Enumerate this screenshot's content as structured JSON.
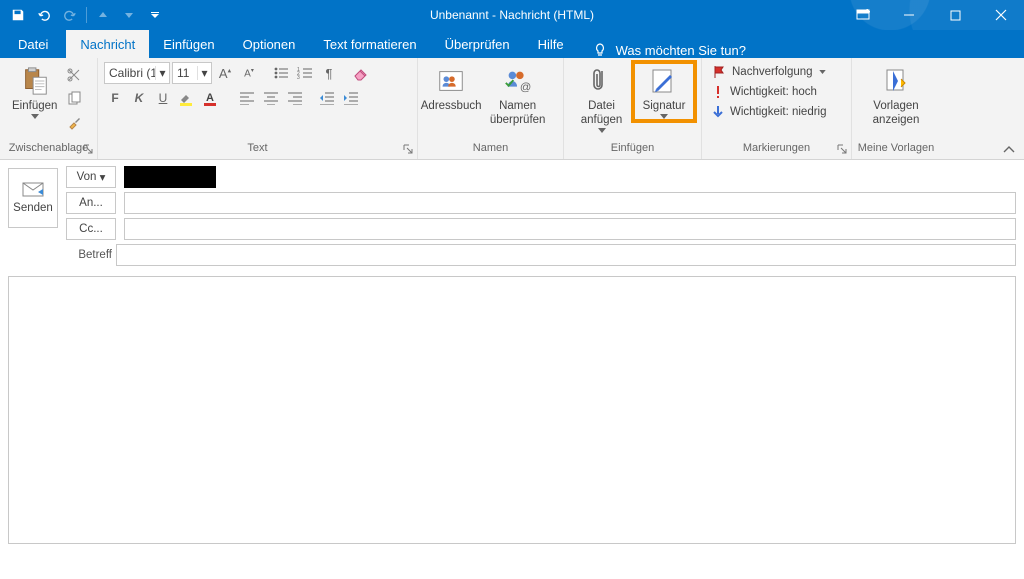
{
  "window": {
    "title": "Unbenannt  -  Nachricht (HTML)"
  },
  "tabs": {
    "file": "Datei",
    "message": "Nachricht",
    "insert": "Einfügen",
    "options": "Optionen",
    "format": "Text formatieren",
    "review": "Überprüfen",
    "help": "Hilfe",
    "tellme": "Was möchten Sie tun?"
  },
  "ribbon": {
    "clipboard": {
      "paste": "Einfügen",
      "group": "Zwischenablage"
    },
    "font": {
      "name": "Calibri (1",
      "size": "11",
      "group": "Text"
    },
    "names": {
      "addressbook": "Adressbuch",
      "checknames": "Namen überprüfen",
      "group": "Namen"
    },
    "include": {
      "attachfile": "Datei anfügen",
      "signature": "Signatur",
      "group": "Einfügen"
    },
    "tags": {
      "followup": "Nachverfolgung",
      "high": "Wichtigkeit: hoch",
      "low": "Wichtigkeit: niedrig",
      "group": "Markierungen"
    },
    "templates": {
      "show": "Vorlagen anzeigen",
      "group": "Meine Vorlagen"
    }
  },
  "compose": {
    "send": "Senden",
    "from": "Von",
    "to": "An...",
    "cc": "Cc...",
    "subject": "Betreff"
  }
}
